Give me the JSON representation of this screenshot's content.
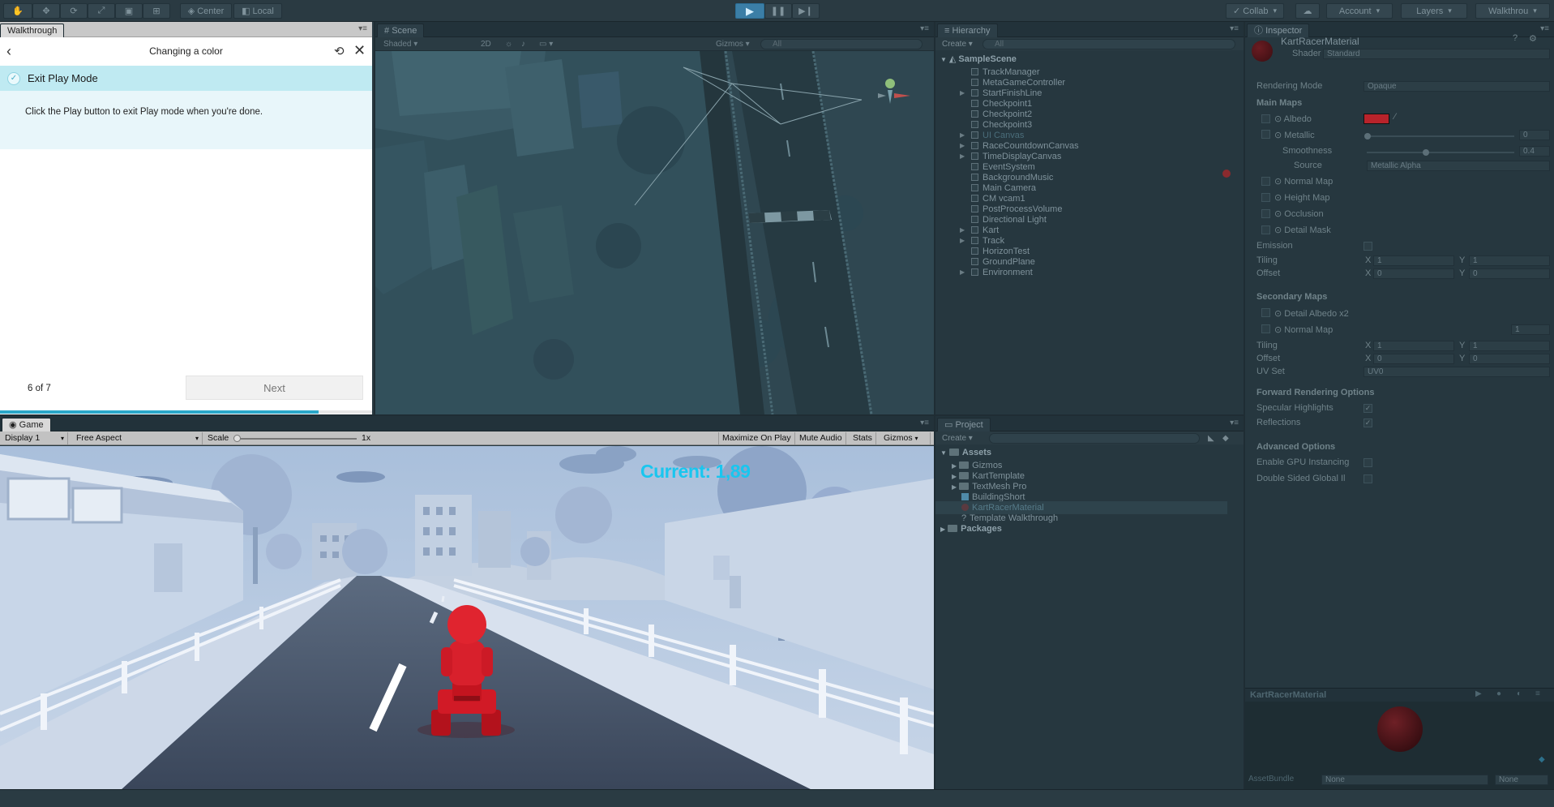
{
  "toolbar": {
    "pivot_label": "Center",
    "space_label": "Local",
    "collab_label": "Collab",
    "account_label": "Account",
    "layers_label": "Layers",
    "layout_label": "Walkthrou"
  },
  "walkthrough": {
    "tab_label": "Walkthrough",
    "title": "Changing a color",
    "step_title": "Exit Play Mode",
    "description": "Click the Play button to exit Play mode when you're done.",
    "progress_text": "6 of 7",
    "progress_fraction": 0.857,
    "next_label": "Next"
  },
  "scene": {
    "tab_label": "Scene",
    "shading_label": "Shaded",
    "mode_2d_label": "2D",
    "gizmos_label": "Gizmos",
    "search_placeholder": "All"
  },
  "hierarchy": {
    "tab_label": "Hierarchy",
    "create_label": "Create",
    "search_placeholder": "All",
    "scene_name": "SampleScene",
    "items": [
      {
        "label": "TrackManager",
        "expandable": false,
        "dim": false
      },
      {
        "label": "MetaGameController",
        "expandable": false,
        "dim": false
      },
      {
        "label": "StartFinishLine",
        "expandable": true,
        "dim": false
      },
      {
        "label": "Checkpoint1",
        "expandable": false,
        "dim": false
      },
      {
        "label": "Checkpoint2",
        "expandable": false,
        "dim": false
      },
      {
        "label": "Checkpoint3",
        "expandable": false,
        "dim": false
      },
      {
        "label": "UI Canvas",
        "expandable": true,
        "dim": true
      },
      {
        "label": "RaceCountdownCanvas",
        "expandable": true,
        "dim": false
      },
      {
        "label": "TimeDisplayCanvas",
        "expandable": true,
        "dim": false
      },
      {
        "label": "EventSystem",
        "expandable": false,
        "dim": false
      },
      {
        "label": "BackgroundMusic",
        "expandable": false,
        "dim": false
      },
      {
        "label": "Main Camera",
        "expandable": false,
        "dim": false
      },
      {
        "label": "CM vcam1",
        "expandable": false,
        "dim": false
      },
      {
        "label": "PostProcessVolume",
        "expandable": false,
        "dim": false
      },
      {
        "label": "Directional Light",
        "expandable": false,
        "dim": false
      },
      {
        "label": "Kart",
        "expandable": true,
        "dim": false
      },
      {
        "label": "Track",
        "expandable": true,
        "dim": false
      },
      {
        "label": "HorizonTest",
        "expandable": false,
        "dim": false
      },
      {
        "label": "GroundPlane",
        "expandable": false,
        "dim": false
      },
      {
        "label": "Environment",
        "expandable": true,
        "dim": false
      }
    ]
  },
  "inspector": {
    "tab_label": "Inspector",
    "material_name": "KartRacerMaterial",
    "shader_label": "Shader",
    "shader_value": "Standard",
    "rendering_mode_label": "Rendering Mode",
    "rendering_mode_value": "Opaque",
    "main_maps_label": "Main Maps",
    "albedo_label": "Albedo",
    "albedo_color": "#b8232b",
    "metallic_label": "Metallic",
    "metallic_value": "0",
    "smoothness_label": "Smoothness",
    "smoothness_value": "0.4",
    "source_label": "Source",
    "source_value": "Metallic Alpha",
    "normal_map_label": "Normal Map",
    "height_map_label": "Height Map",
    "occlusion_label": "Occlusion",
    "detail_mask_label": "Detail Mask",
    "emission_label": "Emission",
    "tiling_label": "Tiling",
    "offset_label": "Offset",
    "x_label": "X",
    "y_label": "Y",
    "tiling_x": "1",
    "tiling_y": "1",
    "offset_x": "0",
    "offset_y": "0",
    "secondary_maps_label": "Secondary Maps",
    "detail_albedo_label": "Detail Albedo x2",
    "secondary_normal_label": "Normal Map",
    "secondary_normal_value": "1",
    "sec_tiling_x": "1",
    "sec_tiling_y": "1",
    "sec_offset_x": "0",
    "sec_offset_y": "0",
    "uv_set_label": "UV Set",
    "uv_set_value": "UV0",
    "forward_label": "Forward Rendering Options",
    "specular_label": "Specular Highlights",
    "reflections_label": "Reflections",
    "advanced_label": "Advanced Options",
    "gpu_instancing_label": "Enable GPU Instancing",
    "double_sided_label": "Double Sided Global Il"
  },
  "game": {
    "tab_label": "Game",
    "display_label": "Display 1",
    "aspect_label": "Free Aspect",
    "scale_label": "Scale",
    "scale_value": "1x",
    "maximize_label": "Maximize On Play",
    "mute_label": "Mute Audio",
    "stats_label": "Stats",
    "gizmos_label": "Gizmos",
    "hud_text": "Current: 1,89"
  },
  "project": {
    "tab_label": "Project",
    "create_label": "Create",
    "assets_label": "Assets",
    "items": [
      {
        "label": "Gizmos",
        "type": "folder",
        "highlight": false
      },
      {
        "label": "KartTemplate",
        "type": "folder",
        "highlight": false
      },
      {
        "label": "TextMesh Pro",
        "type": "folder",
        "highlight": false
      },
      {
        "label": "BuildingShort",
        "type": "prefab",
        "highlight": false
      },
      {
        "label": "KartRacerMaterial",
        "type": "material",
        "highlight": true
      },
      {
        "label": "Template Walkthrough",
        "type": "asset",
        "highlight": false
      }
    ],
    "packages_label": "Packages"
  },
  "preview": {
    "title": "KartRacerMaterial",
    "assetbundle_label": "AssetBundle",
    "assetbundle_value": "None",
    "variant_value": "None"
  }
}
